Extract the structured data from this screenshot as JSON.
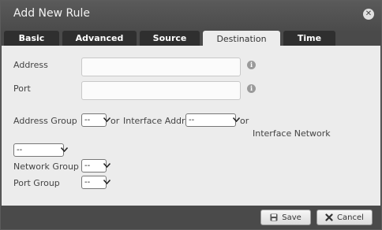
{
  "dialog": {
    "title": "Add New Rule",
    "close_icon": "close-icon"
  },
  "tabs": [
    {
      "label": "Basic",
      "active": false
    },
    {
      "label": "Advanced",
      "active": false
    },
    {
      "label": "Source",
      "active": false
    },
    {
      "label": "Destination",
      "active": true
    },
    {
      "label": "Time",
      "active": false
    }
  ],
  "form": {
    "address_label": "Address",
    "address_value": "",
    "port_label": "Port",
    "port_value": "",
    "address_group_label": "Address Group",
    "address_group_value": "--",
    "or_1": "or",
    "interface_addr_label": "Interface Addr",
    "interface_addr_value": "--",
    "or_2": "or",
    "interface_network_label": "Interface Network",
    "interface_network_value": "--",
    "network_group_label": "Network Group",
    "network_group_value": "--",
    "port_group_label": "Port Group",
    "port_group_value": "--"
  },
  "footer": {
    "save_label": "Save",
    "cancel_label": "Cancel"
  }
}
